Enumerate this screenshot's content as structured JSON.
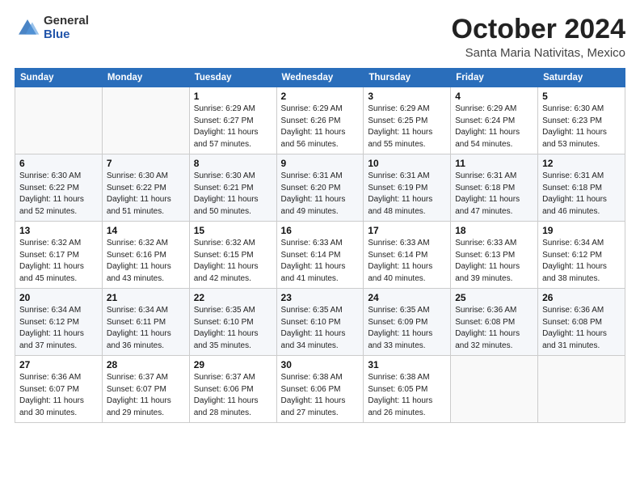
{
  "header": {
    "logo_general": "General",
    "logo_blue": "Blue",
    "month": "October 2024",
    "location": "Santa Maria Nativitas, Mexico"
  },
  "days_of_week": [
    "Sunday",
    "Monday",
    "Tuesday",
    "Wednesday",
    "Thursday",
    "Friday",
    "Saturday"
  ],
  "weeks": [
    [
      {
        "day": "",
        "info": ""
      },
      {
        "day": "",
        "info": ""
      },
      {
        "day": "1",
        "info": "Sunrise: 6:29 AM\nSunset: 6:27 PM\nDaylight: 11 hours and 57 minutes."
      },
      {
        "day": "2",
        "info": "Sunrise: 6:29 AM\nSunset: 6:26 PM\nDaylight: 11 hours and 56 minutes."
      },
      {
        "day": "3",
        "info": "Sunrise: 6:29 AM\nSunset: 6:25 PM\nDaylight: 11 hours and 55 minutes."
      },
      {
        "day": "4",
        "info": "Sunrise: 6:29 AM\nSunset: 6:24 PM\nDaylight: 11 hours and 54 minutes."
      },
      {
        "day": "5",
        "info": "Sunrise: 6:30 AM\nSunset: 6:23 PM\nDaylight: 11 hours and 53 minutes."
      }
    ],
    [
      {
        "day": "6",
        "info": "Sunrise: 6:30 AM\nSunset: 6:22 PM\nDaylight: 11 hours and 52 minutes."
      },
      {
        "day": "7",
        "info": "Sunrise: 6:30 AM\nSunset: 6:22 PM\nDaylight: 11 hours and 51 minutes."
      },
      {
        "day": "8",
        "info": "Sunrise: 6:30 AM\nSunset: 6:21 PM\nDaylight: 11 hours and 50 minutes."
      },
      {
        "day": "9",
        "info": "Sunrise: 6:31 AM\nSunset: 6:20 PM\nDaylight: 11 hours and 49 minutes."
      },
      {
        "day": "10",
        "info": "Sunrise: 6:31 AM\nSunset: 6:19 PM\nDaylight: 11 hours and 48 minutes."
      },
      {
        "day": "11",
        "info": "Sunrise: 6:31 AM\nSunset: 6:18 PM\nDaylight: 11 hours and 47 minutes."
      },
      {
        "day": "12",
        "info": "Sunrise: 6:31 AM\nSunset: 6:18 PM\nDaylight: 11 hours and 46 minutes."
      }
    ],
    [
      {
        "day": "13",
        "info": "Sunrise: 6:32 AM\nSunset: 6:17 PM\nDaylight: 11 hours and 45 minutes."
      },
      {
        "day": "14",
        "info": "Sunrise: 6:32 AM\nSunset: 6:16 PM\nDaylight: 11 hours and 43 minutes."
      },
      {
        "day": "15",
        "info": "Sunrise: 6:32 AM\nSunset: 6:15 PM\nDaylight: 11 hours and 42 minutes."
      },
      {
        "day": "16",
        "info": "Sunrise: 6:33 AM\nSunset: 6:14 PM\nDaylight: 11 hours and 41 minutes."
      },
      {
        "day": "17",
        "info": "Sunrise: 6:33 AM\nSunset: 6:14 PM\nDaylight: 11 hours and 40 minutes."
      },
      {
        "day": "18",
        "info": "Sunrise: 6:33 AM\nSunset: 6:13 PM\nDaylight: 11 hours and 39 minutes."
      },
      {
        "day": "19",
        "info": "Sunrise: 6:34 AM\nSunset: 6:12 PM\nDaylight: 11 hours and 38 minutes."
      }
    ],
    [
      {
        "day": "20",
        "info": "Sunrise: 6:34 AM\nSunset: 6:12 PM\nDaylight: 11 hours and 37 minutes."
      },
      {
        "day": "21",
        "info": "Sunrise: 6:34 AM\nSunset: 6:11 PM\nDaylight: 11 hours and 36 minutes."
      },
      {
        "day": "22",
        "info": "Sunrise: 6:35 AM\nSunset: 6:10 PM\nDaylight: 11 hours and 35 minutes."
      },
      {
        "day": "23",
        "info": "Sunrise: 6:35 AM\nSunset: 6:10 PM\nDaylight: 11 hours and 34 minutes."
      },
      {
        "day": "24",
        "info": "Sunrise: 6:35 AM\nSunset: 6:09 PM\nDaylight: 11 hours and 33 minutes."
      },
      {
        "day": "25",
        "info": "Sunrise: 6:36 AM\nSunset: 6:08 PM\nDaylight: 11 hours and 32 minutes."
      },
      {
        "day": "26",
        "info": "Sunrise: 6:36 AM\nSunset: 6:08 PM\nDaylight: 11 hours and 31 minutes."
      }
    ],
    [
      {
        "day": "27",
        "info": "Sunrise: 6:36 AM\nSunset: 6:07 PM\nDaylight: 11 hours and 30 minutes."
      },
      {
        "day": "28",
        "info": "Sunrise: 6:37 AM\nSunset: 6:07 PM\nDaylight: 11 hours and 29 minutes."
      },
      {
        "day": "29",
        "info": "Sunrise: 6:37 AM\nSunset: 6:06 PM\nDaylight: 11 hours and 28 minutes."
      },
      {
        "day": "30",
        "info": "Sunrise: 6:38 AM\nSunset: 6:06 PM\nDaylight: 11 hours and 27 minutes."
      },
      {
        "day": "31",
        "info": "Sunrise: 6:38 AM\nSunset: 6:05 PM\nDaylight: 11 hours and 26 minutes."
      },
      {
        "day": "",
        "info": ""
      },
      {
        "day": "",
        "info": ""
      }
    ]
  ]
}
